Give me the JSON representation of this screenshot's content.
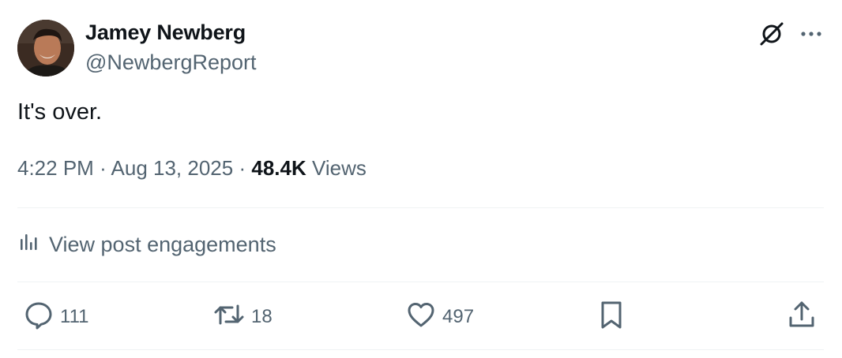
{
  "author": {
    "name": "Jamey Newberg",
    "handle": "@NewbergReport"
  },
  "post": {
    "text": "It's over.",
    "time": "4:22 PM",
    "separator": "·",
    "date": "Aug 13, 2025",
    "views_count": "48.4K",
    "views_label": "Views"
  },
  "engagements": {
    "label": "View post engagements"
  },
  "actions": {
    "replies": "111",
    "reposts": "18",
    "likes": "497"
  },
  "icons": {
    "header": [
      "grok-icon",
      "more-icon"
    ],
    "actions": [
      "reply-icon",
      "repost-icon",
      "like-icon",
      "bookmark-icon",
      "share-icon"
    ]
  },
  "colors": {
    "primary_text": "#0f1419",
    "secondary_text": "#536471",
    "divider": "#eff3f4"
  }
}
